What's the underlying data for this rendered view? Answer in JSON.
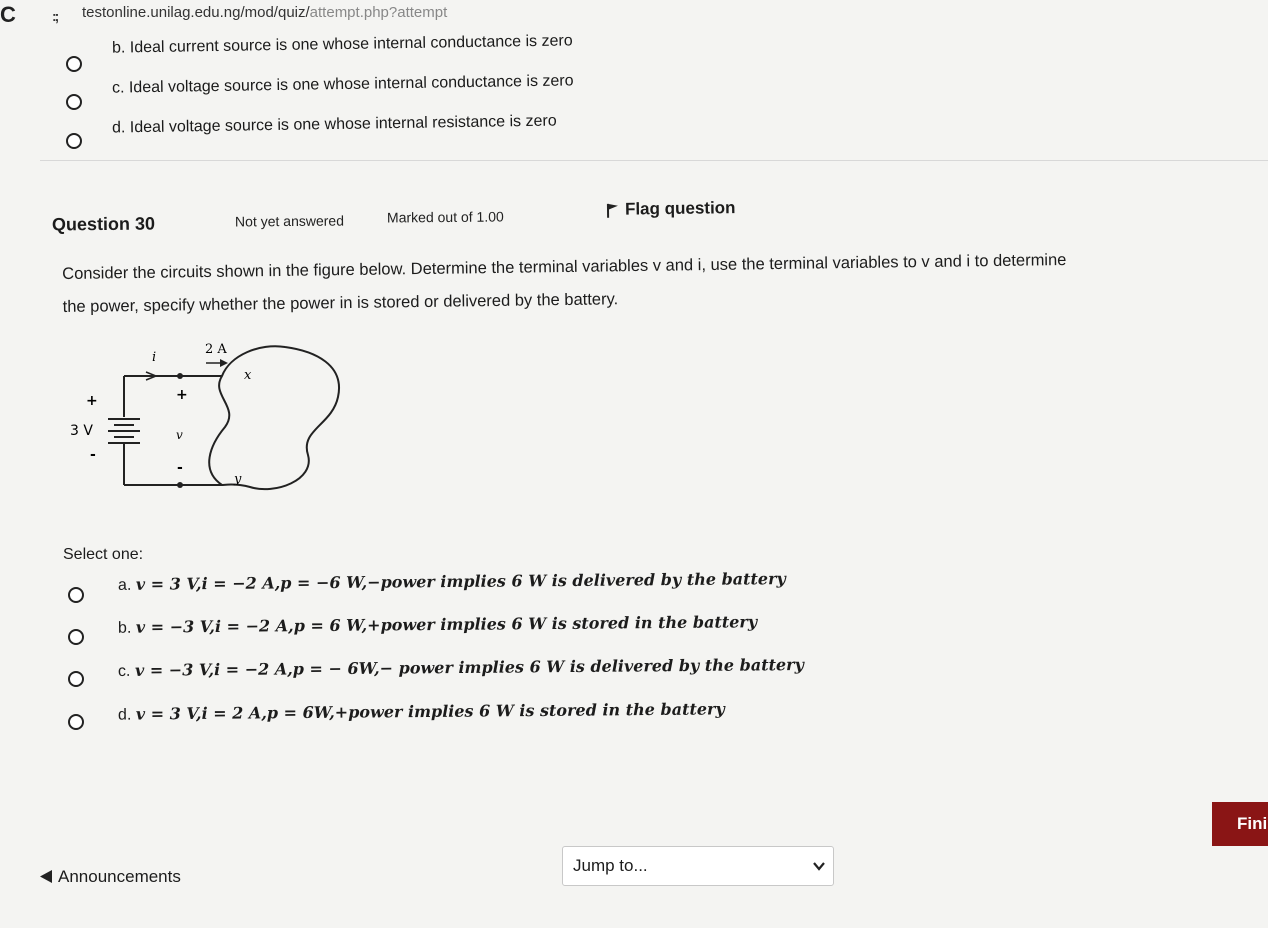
{
  "browser": {
    "reload_glyph": "C",
    "site_icon_glyph": ":;",
    "url_main": "testonline.unilag.edu.ng/mod/quiz/",
    "url_faded": "attempt.php?attempt"
  },
  "prev_question": {
    "options": [
      {
        "label": "b. Ideal current source is one whose internal conductance is zero"
      },
      {
        "label": "c. Ideal voltage source is one whose internal conductance is zero"
      },
      {
        "label": "d. Ideal voltage source is one whose internal resistance is zero"
      }
    ]
  },
  "question": {
    "title": "Question 30",
    "status": "Not yet answered",
    "marks": "Marked out of 1.00",
    "flag_icon": "flag-icon",
    "flag_label": "Flag question",
    "text_line1": "Consider the circuits shown in the figure below. Determine the terminal variables v and i, use the terminal variables to v and i to determine",
    "text_line2": "the power, specify whether the power in is stored or delivered by the battery.",
    "figure": {
      "current_label": "i",
      "source_current": "2 A",
      "battery_voltage": "3 V",
      "plus": "+",
      "minus": "-",
      "voltage_label": "v",
      "node_x": "x",
      "node_y": "y"
    },
    "select_label": "Select one:",
    "answers": [
      {
        "prefix": "a. ",
        "math": "v = 3 V,i = −2 A,p = −6 W,−power implies 6 W is delivered by the battery"
      },
      {
        "prefix": "b. ",
        "math": "v = −3 V,i = −2 A,p = 6 W,+power implies 6 W is stored in the battery"
      },
      {
        "prefix": "c. ",
        "math": "v = −3 V,i = −2 A,p = − 6W,− power implies 6 W is delivered by the battery"
      },
      {
        "prefix": "d. ",
        "math": "v = 3 V,i = 2 A,p = 6W,+power implies 6 W is stored in the battery"
      }
    ]
  },
  "footer": {
    "announcements_icon": "triangle-left-icon",
    "announcements_label": "Announcements",
    "jump_label": "Jump to...",
    "jump_icon": "chevron-down-icon",
    "finish_label": "Fini"
  }
}
